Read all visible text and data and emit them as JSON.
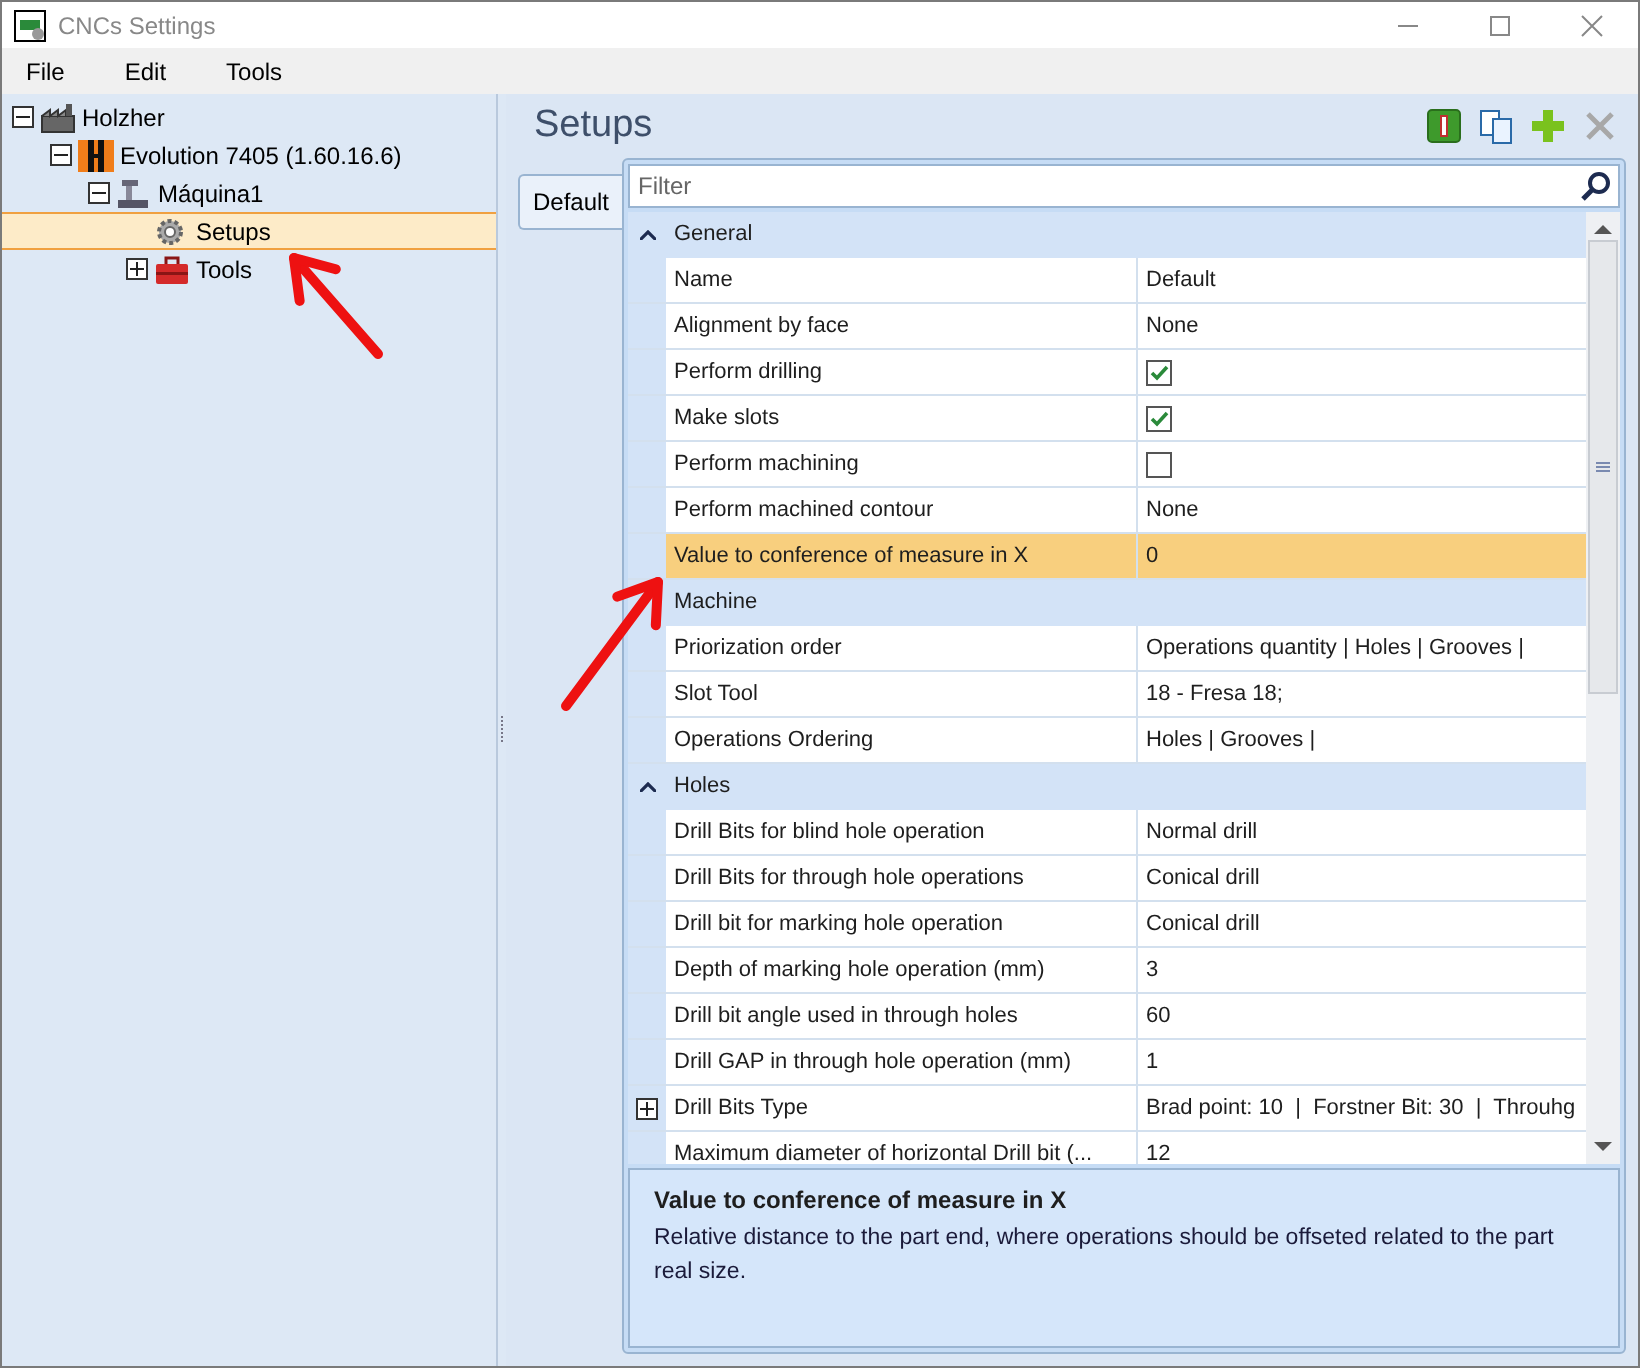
{
  "window": {
    "title": "CNCs Settings"
  },
  "menu": [
    "File",
    "Edit",
    "Tools"
  ],
  "tree": [
    {
      "label": "Holzher",
      "kind": "factory",
      "expanded": true,
      "selected": false,
      "children": [
        {
          "label": "Evolution 7405 (1.60.16.6)",
          "kind": "machine",
          "expanded": true,
          "selected": false,
          "children": [
            {
              "label": "Máquina1",
              "kind": "cnc",
              "expanded": true,
              "selected": false,
              "children": [
                {
                  "label": "Setups",
                  "kind": "gear",
                  "selected": true
                },
                {
                  "label": "Tools",
                  "kind": "toolbox",
                  "expanded": false,
                  "selected": false
                }
              ]
            }
          ]
        }
      ]
    }
  ],
  "panel": {
    "title": "Setups",
    "toolbar": [
      {
        "kind": "info",
        "disabled": false
      },
      {
        "kind": "copy",
        "disabled": false
      },
      {
        "kind": "add",
        "disabled": false
      },
      {
        "kind": "delete",
        "disabled": true
      }
    ],
    "tabs": [
      {
        "label": "Default",
        "selected": true
      }
    ],
    "filter": {
      "placeholder": "Filter"
    },
    "groups": [
      {
        "title": "General",
        "caret": true,
        "rows": [
          {
            "kind": "text",
            "name": "Name",
            "value": "Default",
            "selected": false
          },
          {
            "kind": "text",
            "name": "Alignment by face",
            "value": "None",
            "selected": false
          },
          {
            "kind": "check",
            "name": "Perform drilling",
            "checked": true,
            "selected": false
          },
          {
            "kind": "check",
            "name": "Make slots",
            "checked": true,
            "selected": false
          },
          {
            "kind": "check",
            "name": "Perform machining",
            "checked": false,
            "selected": false
          },
          {
            "kind": "text",
            "name": "Perform machined contour",
            "value": "None",
            "selected": false
          },
          {
            "kind": "text",
            "name": "Value to conference of measure in X",
            "value": "0",
            "selected": true
          }
        ]
      },
      {
        "title": "Machine",
        "caret": false,
        "rows": [
          {
            "kind": "text",
            "name": "Priorization order",
            "value": "Operations quantity | Holes | Grooves |",
            "selected": false
          },
          {
            "kind": "text",
            "name": "Slot Tool",
            "value": "18 - Fresa 18;",
            "selected": false
          },
          {
            "kind": "text",
            "name": "Operations Ordering",
            "value": "Holes | Grooves |",
            "selected": false
          }
        ]
      },
      {
        "title": "Holes",
        "caret": true,
        "rows": [
          {
            "kind": "text",
            "name": "Drill Bits for blind hole operation",
            "value": "Normal drill",
            "selected": false
          },
          {
            "kind": "text",
            "name": "Drill Bits for through hole operations",
            "value": "Conical drill",
            "selected": false
          },
          {
            "kind": "text",
            "name": "Drill bit for marking hole operation",
            "value": "Conical drill",
            "selected": false
          },
          {
            "kind": "text",
            "name": "Depth of marking hole operation (mm)",
            "value": "3",
            "selected": false
          },
          {
            "kind": "text",
            "name": "Drill bit angle used in through holes",
            "value": "60",
            "selected": false
          },
          {
            "kind": "text",
            "name": "Drill GAP in through hole operation (mm)",
            "value": "1",
            "selected": false
          },
          {
            "kind": "expandable",
            "name": "Drill Bits Type",
            "value": "Brad point: 10  |  Forstner Bit: 30  |  Throuhg",
            "selected": false
          },
          {
            "kind": "text",
            "name": "Maximum diameter of horizontal Drill bit (...",
            "value": "12",
            "selected": false
          }
        ]
      }
    ],
    "description": {
      "title": "Value to conference of measure in X",
      "text": "Relative distance to the part end, where operations should be offseted related to the part real size."
    }
  },
  "annotations": [
    {
      "kind": "arrow"
    },
    {
      "kind": "arrow"
    }
  ]
}
